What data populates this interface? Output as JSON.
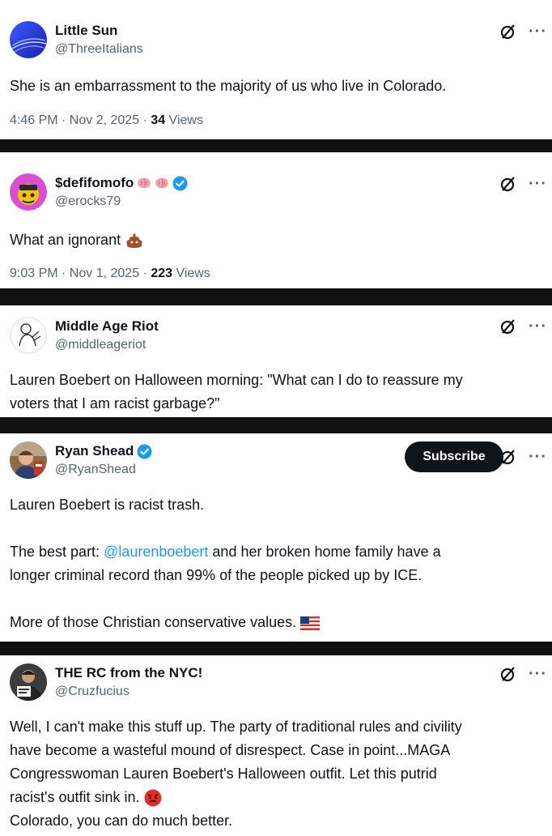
{
  "posts": [
    {
      "name": "Little Sun",
      "handle": "@ThreeItalians",
      "text": "She is an embarrassment to the majority of us who live in Colorado.",
      "time": "4:46 PM · Nov 2, 2025 · ",
      "views_count": "34",
      "views_label": " Views"
    },
    {
      "name": "$defifomofo",
      "name_emojis": "brain-emoji brain-emoji",
      "handle": "@erocks79",
      "text": "What an ignorant",
      "text_emoji": "poop-emoji",
      "time": "9:03 PM · Nov 1, 2025 · ",
      "views_count": "223",
      "views_label": " Views"
    },
    {
      "name": "Middle Age Riot",
      "handle": "@middleageriot",
      "text_lines": [
        "Lauren Boebert on Halloween morning: \"What can I do to reassure my",
        "voters that I am racist garbage?\""
      ]
    },
    {
      "name": "Ryan Shead",
      "handle": "@RyanShead",
      "subscribe_label": "Subscribe",
      "line1": "Lauren Boebert is racist trash.",
      "line2_pre": "The best part: ",
      "line2_mention": "@laurenboebert",
      "line2_post": " and her broken home family have a",
      "line3": "longer criminal record than 99% of the people picked up by ICE.",
      "line4": "More of those Christian conservative values.",
      "line4_emoji": "us-flag-emoji"
    },
    {
      "name": "THE RC from the NYC!",
      "handle": "@Cruzfucius",
      "text_lines": [
        "Well, I can't make this stuff up.  The party of traditional rules and civility",
        "have become a wasteful mound of disrespect.  Case in point...MAGA",
        "Congresswoman Lauren Boebert's Halloween outfit.  Let this putrid",
        "racist's outfit sink in."
      ],
      "last_line": "Colorado, you can do much better.",
      "text_emoji": "angry-face-emoji"
    }
  ],
  "colors": {
    "text": "#0f1419",
    "secondary": "#536471",
    "accent": "#1d9bf0",
    "button_bg": "#0f1419"
  }
}
